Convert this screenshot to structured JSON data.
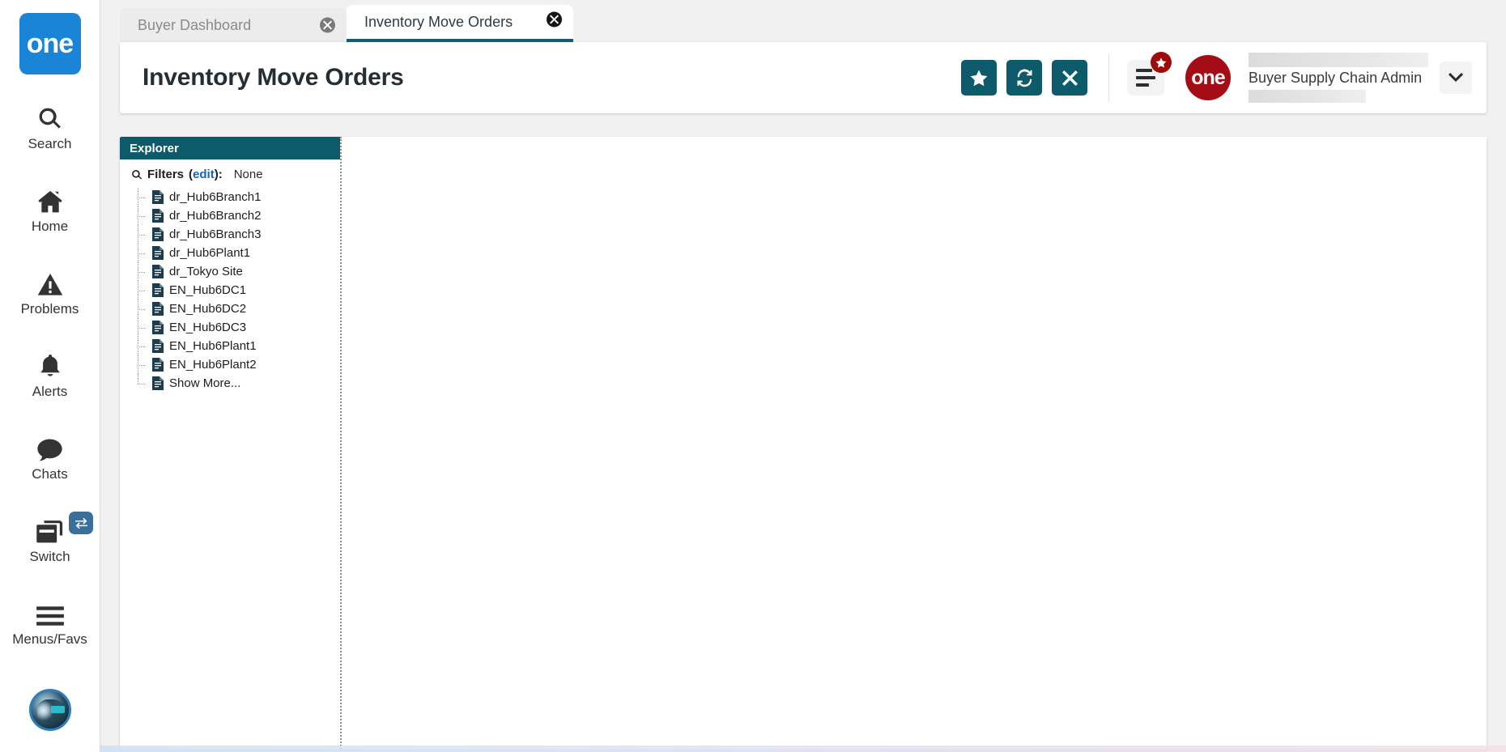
{
  "brand": {
    "rail_logo_text": "one",
    "header_logo_text": "one",
    "accent_teal": "#0d5a6b",
    "accent_blue": "#1a85d6",
    "accent_red": "#a50d16",
    "badge_red": "#9d0b0b",
    "link_blue": "#1565c0"
  },
  "rail": {
    "items": [
      {
        "label": "Search",
        "icon": "search-icon"
      },
      {
        "label": "Home",
        "icon": "home-icon"
      },
      {
        "label": "Problems",
        "icon": "warning-triangle-icon"
      },
      {
        "label": "Alerts",
        "icon": "bell-icon"
      },
      {
        "label": "Chats",
        "icon": "chat-bubble-icon"
      },
      {
        "label": "Switch",
        "icon": "switch-windows-icon",
        "badge_icon": "transfer-arrows-icon"
      },
      {
        "label": "Menus/Favs",
        "icon": "hamburger-icon"
      }
    ],
    "avatar_icon": "robot-avatar-icon"
  },
  "tabs": [
    {
      "label": "Buyer Dashboard",
      "active": false,
      "close_icon": "close-circle-icon"
    },
    {
      "label": "Inventory Move Orders",
      "active": true,
      "close_icon": "close-circle-icon"
    }
  ],
  "header": {
    "title": "Inventory Move Orders",
    "actions": [
      {
        "name": "favorite-button",
        "icon": "star-icon"
      },
      {
        "name": "refresh-button",
        "icon": "refresh-icon"
      },
      {
        "name": "close-page-button",
        "icon": "x-icon"
      }
    ],
    "menus_favs_button": {
      "icon": "menu-lines-icon",
      "badge_icon": "star-icon"
    },
    "user": {
      "name": "Buyer Supply Chain Admin",
      "dropdown_icon": "chevron-down-icon"
    }
  },
  "explorer": {
    "title": "Explorer",
    "filters": {
      "icon": "search-icon",
      "label": "Filters",
      "edit_link": "edit",
      "suffix": ":",
      "value": "None"
    },
    "tree_items": [
      {
        "label": "dr_Hub6Branch1",
        "icon": "document-icon"
      },
      {
        "label": "dr_Hub6Branch2",
        "icon": "document-icon"
      },
      {
        "label": "dr_Hub6Branch3",
        "icon": "document-icon"
      },
      {
        "label": "dr_Hub6Plant1",
        "icon": "document-icon"
      },
      {
        "label": "dr_Tokyo Site",
        "icon": "document-icon"
      },
      {
        "label": "EN_Hub6DC1",
        "icon": "document-icon"
      },
      {
        "label": "EN_Hub6DC2",
        "icon": "document-icon"
      },
      {
        "label": "EN_Hub6DC3",
        "icon": "document-icon"
      },
      {
        "label": "EN_Hub6Plant1",
        "icon": "document-icon"
      },
      {
        "label": "EN_Hub6Plant2",
        "icon": "document-icon"
      },
      {
        "label": "Show More...",
        "icon": "document-icon"
      }
    ]
  }
}
